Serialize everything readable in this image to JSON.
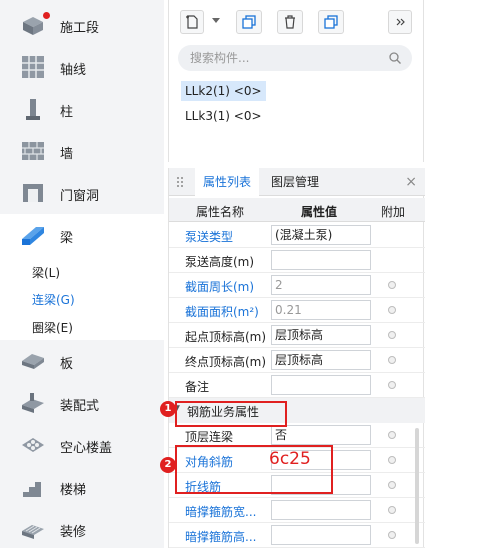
{
  "sidebar": {
    "items": [
      {
        "label": "施工段",
        "icon": "construction-section-icon"
      },
      {
        "label": "轴线",
        "icon": "grid-axis-icon"
      },
      {
        "label": "柱",
        "icon": "column-icon"
      },
      {
        "label": "墙",
        "icon": "wall-icon"
      },
      {
        "label": "门窗洞",
        "icon": "door-window-icon"
      },
      {
        "label": "梁",
        "icon": "beam-icon"
      },
      {
        "label": "板",
        "icon": "slab-icon"
      },
      {
        "label": "装配式",
        "icon": "prefab-icon"
      },
      {
        "label": "空心楼盖",
        "icon": "hollow-floor-icon"
      },
      {
        "label": "楼梯",
        "icon": "stair-icon"
      },
      {
        "label": "装修",
        "icon": "decoration-icon"
      }
    ],
    "beam_sub": [
      "梁(L)",
      "连梁(G)",
      "圈梁(E)"
    ]
  },
  "toolbar": {
    "new_icon": "new-component-icon",
    "copy_icon": "copy-icon",
    "delete_icon": "delete-icon",
    "layer_copy_icon": "layer-copy-icon",
    "more_icon": "double-arrow-icon"
  },
  "search": {
    "placeholder": "搜索构件..."
  },
  "components": [
    "LLk2(1) <0>",
    "LLk3(1) <0>"
  ],
  "props": {
    "tabs": [
      "属性列表",
      "图层管理"
    ],
    "close": "×",
    "headers": {
      "name": "属性名称",
      "value": "属性值",
      "extra": "附加"
    },
    "rows": [
      {
        "name": "泵送类型",
        "value": "(混凝土泵)"
      },
      {
        "name": "泵送高度(m)",
        "value": ""
      },
      {
        "name": "截面周长(m)",
        "value": "2"
      },
      {
        "name": "截面面积(m²)",
        "value": "0.21"
      },
      {
        "name": "起点顶标高(m)",
        "value": "层顶标高"
      },
      {
        "name": "终点顶标高(m)",
        "value": "层顶标高"
      },
      {
        "name": "备注",
        "value": ""
      }
    ],
    "group": "钢筋业务属性",
    "group_rows": [
      {
        "name": "顶层连梁",
        "value": "否"
      },
      {
        "name": "对角斜筋",
        "value": ""
      },
      {
        "name": "折线筋",
        "value": ""
      },
      {
        "name": "暗撑箍筋宽...",
        "value": ""
      },
      {
        "name": "暗撑箍筋高...",
        "value": ""
      }
    ]
  },
  "annotations": {
    "badge1": "1",
    "badge2": "2",
    "text": "6c25"
  },
  "colors": {
    "accent": "#1a73d8",
    "annotation": "#e02020",
    "selected_bg": "#d7e8fb"
  }
}
